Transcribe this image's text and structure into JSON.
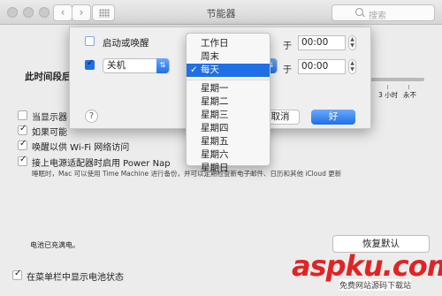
{
  "window": {
    "title": "节能器"
  },
  "search": {
    "placeholder": "搜索"
  },
  "background": {
    "schedule_label": "此时间段后关",
    "slider_label_3h": "3 小时",
    "slider_label_never": "永不",
    "cb_display_dim": "当显示器",
    "cb_maybe": "如果可能",
    "cb_wake_wifi": "唤醒以供 Wi-Fi 网络访问",
    "cb_power_nap": "接上电源适配器时启用 Power Nap",
    "power_nap_desc": "睡眠时，Mac 可以使用 Time Machine 进行备份，并可以定期检查新电子邮件、日历和其他 iCloud 更新",
    "battery_status": "电池已充满电。",
    "restore_label": "恢复默认",
    "menubar_battery": "在菜单栏中显示电池状态"
  },
  "sheet": {
    "startup_wake_label": "启动或唤醒",
    "action_value": "关机",
    "at_label_1": "于",
    "at_label_2": "于",
    "time_1": "00:00",
    "time_2": "00:00",
    "help_label": "?",
    "cancel_label": "取消",
    "ok_label": "好"
  },
  "menu": {
    "items_top": [
      "工作日",
      "周末",
      "每天"
    ],
    "selected_index": 2,
    "items_days": [
      "星期一",
      "星期二",
      "星期三",
      "星期四",
      "星期五",
      "星期六",
      "星期日"
    ]
  },
  "watermark": {
    "logo_text": "aspku.com",
    "sub_text": "免费网站源码下载站"
  },
  "colors": {
    "accent": "#1f6fe6",
    "watermark": "#e02424"
  }
}
